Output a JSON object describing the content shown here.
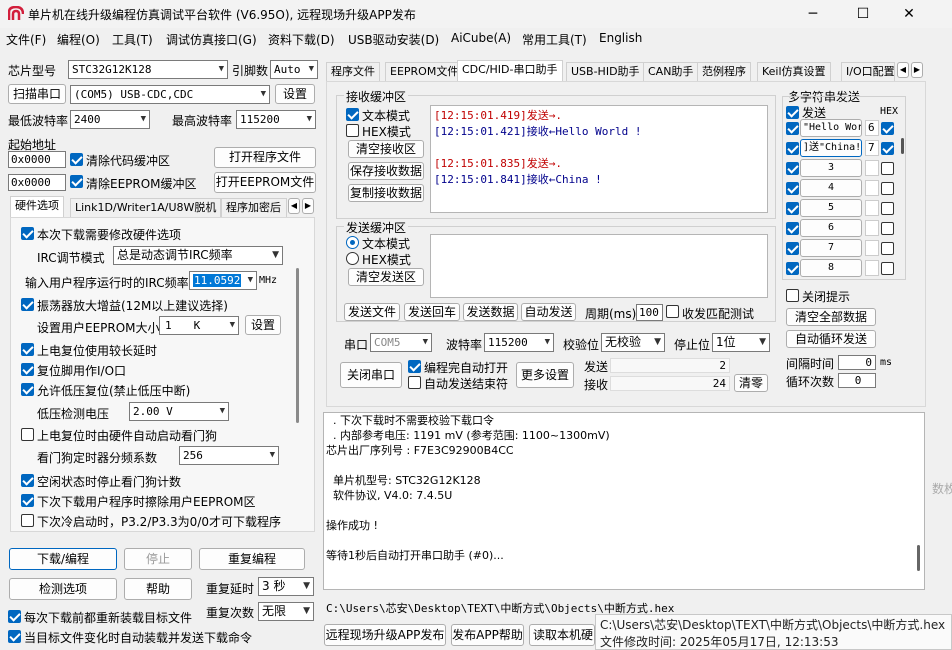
{
  "window": {
    "title": "单片机在线升级编程仿真调试平台软件 (V6.95O), 远程现场升级APP发布",
    "minimize": "─",
    "maximize": "☐",
    "close": "✕"
  },
  "menu": [
    "文件(F)",
    "编程(O)",
    "工具(T)",
    "调试仿真接口(G)",
    "资料下载(D)",
    "USB驱动安装(D)",
    "AiCube(A)",
    "常用工具(T)",
    "English"
  ],
  "left": {
    "chip_label": "芯片型号",
    "chip_value": "STC32G12K128",
    "pins_label": "引脚数",
    "pins_value": "Auto",
    "scan_button": "扫描串口",
    "port_value": "(COM5) USB-CDC,CDC",
    "settings_button": "设置",
    "min_baud_label": "最低波特率",
    "min_baud_value": "2400",
    "max_baud_label": "最高波特率",
    "max_baud_value": "115200",
    "start_addr_label": "起始地址",
    "addr1": "0x0000",
    "clear_code_label": "清除代码缓冲区",
    "open_prog_button": "打开程序文件",
    "addr2": "0x0000",
    "clear_eeprom_label": "清除EEPROM缓冲区",
    "open_eeprom_button": "打开EEPROM文件",
    "tabs": [
      "硬件选项",
      "Link1D/Writer1A/U8W脱机",
      "程序加密后"
    ],
    "options": {
      "o1": "本次下载需要修改硬件选项",
      "irc_mode_label": "IRC调节模式",
      "irc_mode_value": "总是动态调节IRC频率",
      "irc_freq_label": "输入用户程序运行时的IRC频率",
      "irc_freq_value": "11.0592",
      "irc_unit": "MHz",
      "o2": "振荡器放大增益(12M以上建议选择)",
      "eeprom_size_label": "设置用户EEPROM大小",
      "eeprom_size_value": "1",
      "eeprom_unit": "K",
      "eeprom_settings": "设置",
      "o3": "上电复位使用较长延时",
      "o4": "复位脚用作I/O口",
      "o5": "允许低压复位(禁止低压中断)",
      "lv_label": "低压检测电压",
      "lv_value": "2.00 V",
      "o6": "上电复位时由硬件自动启动看门狗",
      "wdt_label": "看门狗定时器分频系数",
      "wdt_value": "256",
      "o7": "空闲状态时停止看门狗计数",
      "o8": "下次下载用户程序时擦除用户EEPROM区",
      "o9": "下次冷启动时，P3.2/P3.3为0/0才可下载程序"
    },
    "download_button": "下载/编程",
    "stop_button": "停止",
    "reprogram_button": "重复编程",
    "check_button": "检测选项",
    "help_button": "帮助",
    "repeat_delay_label": "重复延时",
    "repeat_delay_value": "3 秒",
    "repeat_count_label": "重复次数",
    "repeat_count_value": "无限",
    "reload_label": "每次下载前都重新装载目标文件",
    "auto_send_label": "当目标文件变化时自动装载并发送下载命令"
  },
  "right_tabs": [
    "程序文件",
    "EEPROM文件",
    "CDC/HID-串口助手",
    "USB-HID助手",
    "CAN助手",
    "范例程序",
    "Keil仿真设置",
    "I/O口配置"
  ],
  "serial": {
    "recv_title": "接收缓冲区",
    "text_mode": "文本模式",
    "hex_mode": "HEX模式",
    "clear_recv": "清空接收区",
    "save_recv": "保存接收数据",
    "copy_recv": "复制接收数据",
    "log": [
      {
        "time": "[12:15:01.419]",
        "dir": "发送→",
        "text": "."
      },
      {
        "time": "[12:15:01.421]",
        "dir": "接收←",
        "text": "Hello World !"
      },
      {
        "time": "",
        "dir": "",
        "text": ""
      },
      {
        "time": "[12:15:01.835]",
        "dir": "发送→",
        "text": "."
      },
      {
        "time": "[12:15:01.841]",
        "dir": "接收←",
        "text": "China !"
      }
    ],
    "send_title": "发送缓冲区",
    "send_text_mode": "文本模式",
    "send_hex_mode": "HEX模式",
    "clear_send": "清空发送区",
    "send_file": "发送文件",
    "send_return": "发送回车",
    "send_data": "发送数据",
    "auto_send": "自动发送",
    "period_label": "周期(ms)",
    "period_value": "100",
    "match_label": "收发匹配测试",
    "port_label": "串口",
    "port_value": "COM5",
    "baud_label": "波特率",
    "baud_value": "115200",
    "parity_label": "校验位",
    "parity_value": "无校验",
    "stop_label": "停止位",
    "stop_value": "1位",
    "close_port": "关闭串口",
    "auto_open": "编程完自动打开",
    "auto_end": "自动发送结束符",
    "more_settings": "更多设置",
    "send_count_label": "发送",
    "send_count": "2",
    "recv_count_label": "接收",
    "recv_count": "24",
    "clear_counts": "清零"
  },
  "multi": {
    "title": "多字符串发送",
    "send_col": "发送",
    "hex_col": "HEX",
    "rows": [
      {
        "text": "\"Hello Wor",
        "num": "6",
        "hex": true
      },
      {
        "text": "]送\"China!",
        "num": "7",
        "hex": true
      },
      {
        "text": "3",
        "num": "",
        "hex": false
      },
      {
        "text": "4",
        "num": "",
        "hex": false
      },
      {
        "text": "5",
        "num": "",
        "hex": false
      },
      {
        "text": "6",
        "num": "",
        "hex": false
      },
      {
        "text": "7",
        "num": "",
        "hex": false
      },
      {
        "text": "8",
        "num": "",
        "hex": false
      }
    ],
    "close_tip": "关闭提示",
    "clear_all": "清空全部数据",
    "auto_loop": "自动循环发送",
    "interval_label": "间隔时间",
    "interval_value": "0",
    "interval_unit": "ms",
    "loop_label": "循环次数",
    "loop_value": "0"
  },
  "output": [
    "  . 下次下载时不需要校验下载口令",
    "  . 内部参考电压: 1191 mV (参考范围: 1100~1300mV)",
    "芯片出厂序列号 : F7E3C92900B4CC",
    "",
    "  单片机型号: STC32G12K128",
    "  软件协议, V4.0: 7.4.5U",
    "",
    "操作成功 !",
    "",
    "等待1秒后自动打开串口助手 (#0)..."
  ],
  "path": "C:\\Users\\芯安\\Desktop\\TEXT\\中断方式\\Objects\\中断方式.hex",
  "bottom": {
    "remote_publish": "远程现场升级APP发布",
    "publish_help": "发布APP帮助",
    "read_serial": "读取本机硬"
  },
  "tooltip": {
    "line1": "C:\\Users\\芯安\\Desktop\\TEXT\\中断方式\\Objects\\中断方式.hex",
    "line2": "文件修改时间: 2025年05月17日, 12:13:53"
  },
  "side_text": "数枚"
}
